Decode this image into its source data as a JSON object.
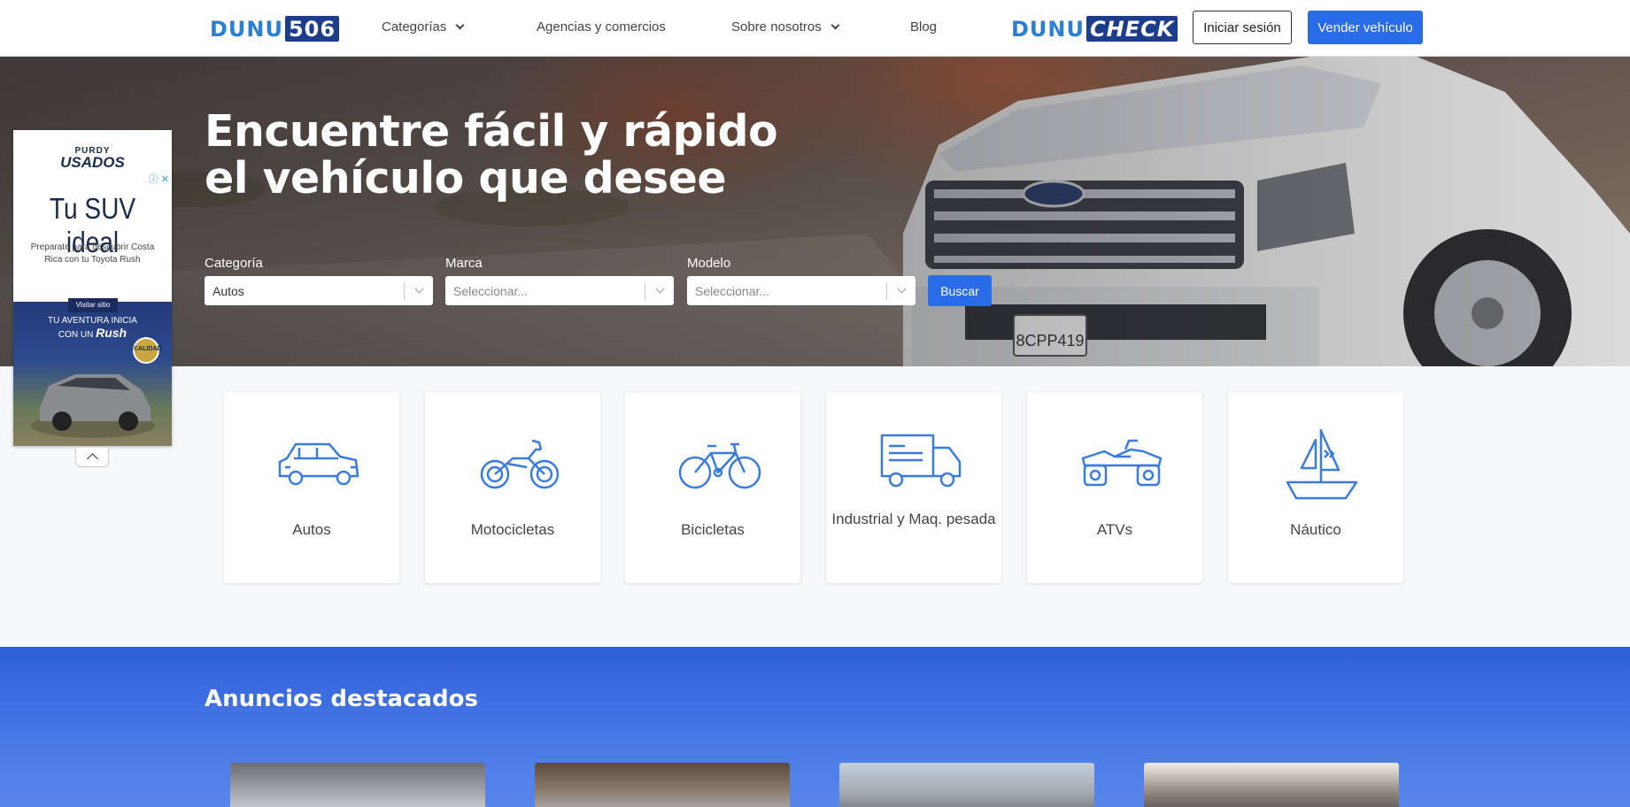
{
  "nav": {
    "logo_word": "DUNU",
    "logo_box": "506",
    "links": {
      "categorias": "Categorías",
      "agencias": "Agencias y comercios",
      "sobre": "Sobre nosotros",
      "blog": "Blog"
    },
    "check_word": "DUNU",
    "check_box": "CHECK",
    "login": "Iniciar sesión",
    "sell": "Vender vehículo"
  },
  "hero": {
    "title_line1": "Encuentre fácil y rápido",
    "title_line2": "el vehículo que desee",
    "plate": "8CPP419"
  },
  "search": {
    "categoria_label": "Categoría",
    "categoria_value": "Autos",
    "marca_label": "Marca",
    "marca_placeholder": "Seleccionar...",
    "modelo_label": "Modelo",
    "modelo_placeholder": "Seleccionar...",
    "button": "Buscar"
  },
  "ad": {
    "brand_top": "PURDY",
    "brand_bottom": "USADOS",
    "close": "ⓘ ✕",
    "headline": "Tu SUV ideal",
    "subtext": "Preparate para descubrir Costa Rica con tu Toyota Rush",
    "visit": "Visitar sitio",
    "tag_line": "TU AVENTURA INICIA",
    "tag_prefix": "CON UN",
    "tag_model": "Rush",
    "badge": "CALIDAD"
  },
  "categories": [
    {
      "label": "Autos",
      "icon": "car-icon"
    },
    {
      "label": "Motocicletas",
      "icon": "motorcycle-icon"
    },
    {
      "label": "Bicicletas",
      "icon": "bicycle-icon"
    },
    {
      "label": "Industrial y Maq. pesada",
      "icon": "truck-icon"
    },
    {
      "label": "ATVs",
      "icon": "atv-icon"
    },
    {
      "label": "Náutico",
      "icon": "sailboat-icon"
    }
  ],
  "featured": {
    "title": "Anuncios destacados"
  },
  "colors": {
    "accent": "#2a6ce8",
    "icon": "#3a7be0",
    "featured_bg": "#2d5fdb",
    "logo_box": "#1c3c8c"
  }
}
